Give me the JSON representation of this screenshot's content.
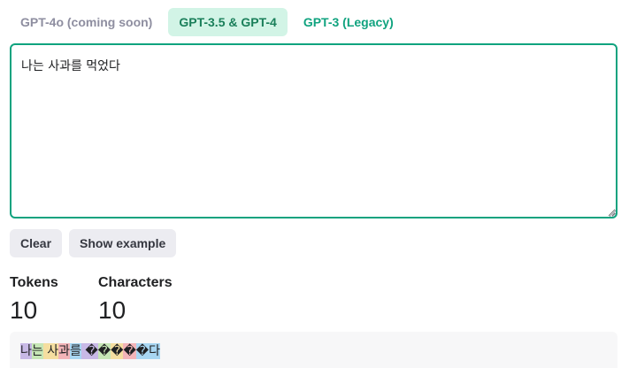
{
  "tabs": [
    {
      "label": "GPT-4o (coming soon)",
      "state": "disabled"
    },
    {
      "label": "GPT-3.5 & GPT-4",
      "state": "active"
    },
    {
      "label": "GPT-3 (Legacy)",
      "state": "inactive"
    }
  ],
  "editor": {
    "value": "나는 사과를 먹었다"
  },
  "actions": {
    "clear_label": "Clear",
    "example_label": "Show example"
  },
  "stats": {
    "tokens_label": "Tokens",
    "tokens_value": "10",
    "characters_label": "Characters",
    "characters_value": "10"
  },
  "tokens": [
    {
      "text": "나",
      "color": "#c8b9e6"
    },
    {
      "text": "는",
      "color": "#c6e6b6"
    },
    {
      "text": " 사",
      "color": "#f5dea0"
    },
    {
      "text": "과",
      "color": "#f3b4b8"
    },
    {
      "text": "를",
      "color": "#a8d6f2"
    },
    {
      "text": " ",
      "color": "#c8b9e6"
    },
    {
      "text": "�",
      "color": "#c8b9e6"
    },
    {
      "text": "�",
      "color": "#c6e6b6"
    },
    {
      "text": "�",
      "color": "#f5dea0"
    },
    {
      "text": "�",
      "color": "#f3b4b8"
    },
    {
      "text": "�다",
      "color": "#a8d6f2"
    }
  ],
  "colors": {
    "accent": "#10a37f",
    "active_tab_bg": "#d2f4e6",
    "button_bg": "#ececf1"
  }
}
